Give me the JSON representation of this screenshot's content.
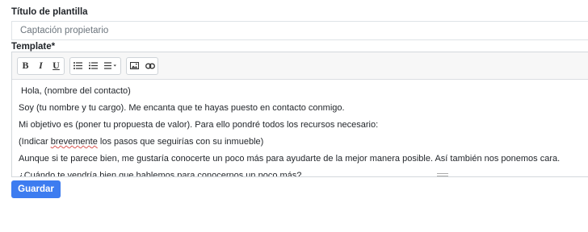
{
  "form": {
    "title_label": "Título de plantilla",
    "title_value": "Captación propietario",
    "template_label": "Template*"
  },
  "toolbar": {
    "bold": "B",
    "italic": "I",
    "underline": "U",
    "icons": [
      "unordered-list-icon",
      "ordered-list-icon",
      "align-dropdown-icon",
      "image-icon",
      "link-icon"
    ]
  },
  "editor": {
    "lines": [
      " Hola, (nombre del contacto)",
      "Soy (tu nombre y tu cargo). Me encanta que te hayas puesto en contacto conmigo.",
      "Mi objetivo es (poner tu propuesta de valor). Para ello pondré todos los recursos necesario:",
      "(Indicar ",
      "brevemente",
      " los pasos que seguirías con su inmueble)",
      "Aunque si te parece bien, me gustaría conocerte un poco más para ayudarte de la mejor manera posible. Así también nos ponemos cara.",
      "¿Cuándo te vendría bien que hablemos para conocernos un poco más?"
    ]
  },
  "actions": {
    "save_label": "Guardar"
  },
  "colors": {
    "accent": "#3d7cf0",
    "spellcheck": "#d9534f"
  }
}
